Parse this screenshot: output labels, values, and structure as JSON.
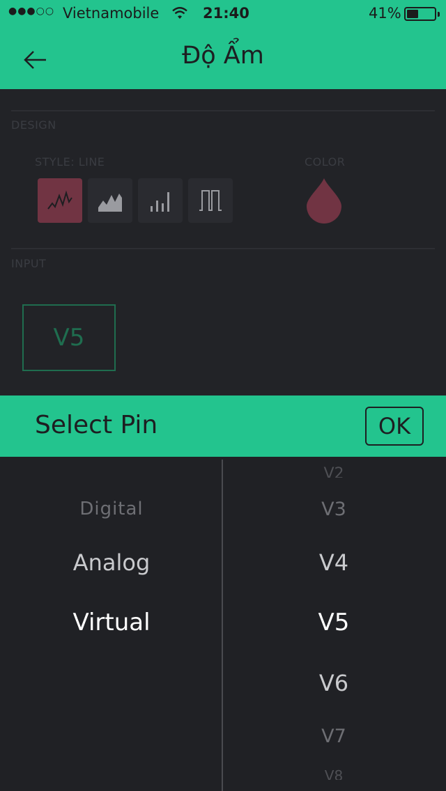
{
  "status_bar": {
    "signal": "●●●○○",
    "carrier": "Vietnamobile",
    "time": "21:40",
    "battery_percent": "41%",
    "battery_level": 0.41
  },
  "nav": {
    "back_icon": "arrow-left-icon",
    "title": "Độ Ẩm"
  },
  "design": {
    "section_label": "DESIGN",
    "style_label": "STYLE: LINE",
    "color_label": "COLOR",
    "styles": [
      {
        "icon": "line-chart-icon",
        "active": true
      },
      {
        "icon": "area-chart-icon",
        "active": false
      },
      {
        "icon": "bar-chart-icon",
        "active": false
      },
      {
        "icon": "binary-chart-icon",
        "active": false
      }
    ],
    "color_value": "#713443"
  },
  "input": {
    "section_label": "INPUT",
    "pin": "V5"
  },
  "select_pin": {
    "title": "Select Pin",
    "ok_label": "OK"
  },
  "picker": {
    "types": [
      "Digital",
      "Analog",
      "Virtual"
    ],
    "selected_type": "Virtual",
    "pins": [
      "V2",
      "V3",
      "V4",
      "V5",
      "V6",
      "V7",
      "V8"
    ],
    "selected_pin": "V5"
  },
  "colors": {
    "accent": "#23c48e",
    "background": "#222327",
    "selected_style": "#713443",
    "pin_outline": "#1f6d4f"
  }
}
